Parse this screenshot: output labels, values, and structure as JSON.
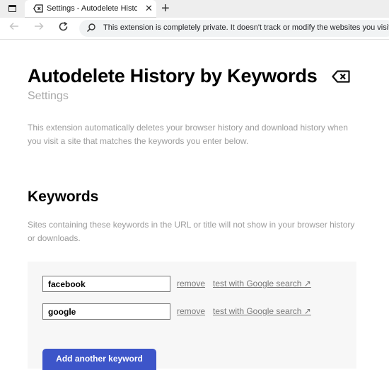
{
  "browser": {
    "tab": {
      "title": "Settings - Autodelete History by Keywords",
      "close_label": "✕"
    },
    "new_tab_label": "+",
    "omnibox_text": "This extension is completely private. It doesn't track or modify the websites you visit.",
    "icons": {
      "window": "window-icon",
      "favicon": "erase-icon",
      "back": "back-arrow-icon",
      "forward": "forward-arrow-icon",
      "reload": "reload-icon",
      "search": "search-icon"
    }
  },
  "page": {
    "title": "Autodelete History by Keywords",
    "subtitle": "Settings",
    "intro": "This extension automatically deletes your browser history and download history when you visit a site that matches the keywords you enter below.",
    "keywords_section": {
      "title": "Keywords",
      "description": "Sites containing these keywords in the URL or title will not show in your browser history or downloads.",
      "keywords": [
        {
          "value": "facebook",
          "remove_label": "remove",
          "test_label": "test with Google search ↗"
        },
        {
          "value": "google",
          "remove_label": "remove",
          "test_label": "test with Google search ↗"
        }
      ],
      "add_button_label": "Add another keyword"
    }
  },
  "colors": {
    "accent": "#3d55c9",
    "muted_text": "#9c9c9c",
    "panel_bg": "#f7f7f7"
  }
}
